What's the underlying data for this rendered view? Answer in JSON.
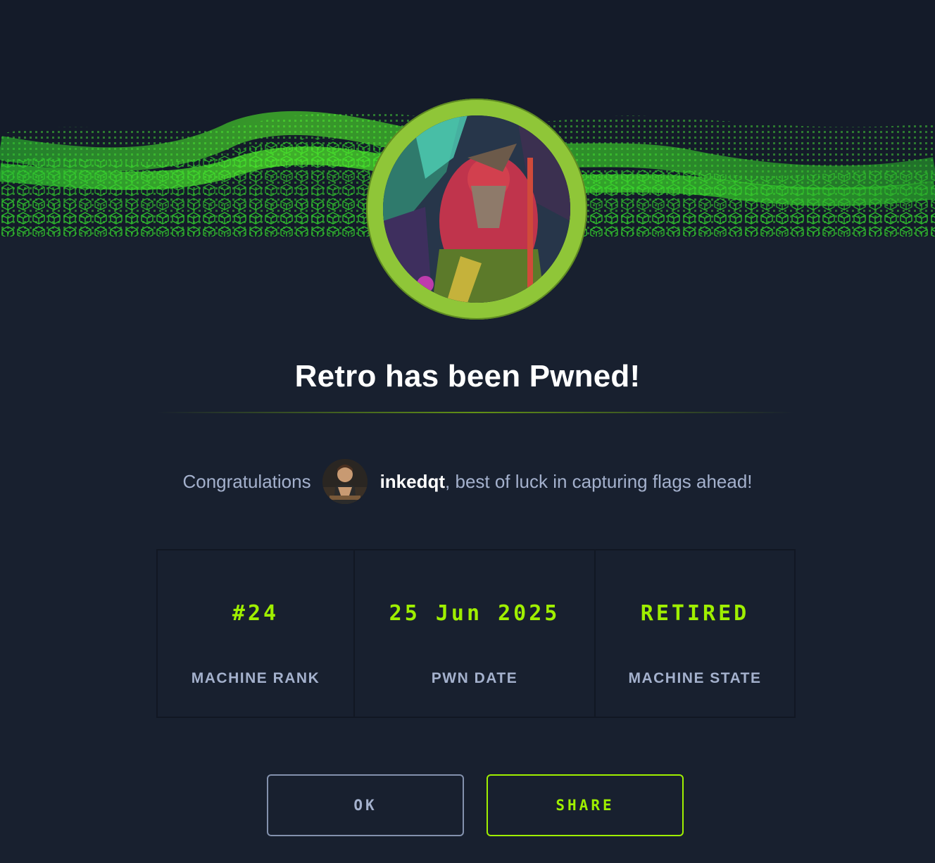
{
  "modal": {
    "title": "Retro has been Pwned!",
    "congrats": {
      "prefix": "Congratulations",
      "username": "inkedqt",
      "suffix": ", best of luck in capturing flags ahead!"
    },
    "stats": [
      {
        "value": "#24",
        "label": "MACHINE RANK"
      },
      {
        "value": "25 Jun 2025",
        "label": "PWN DATE"
      },
      {
        "value": "RETIRED",
        "label": "MACHINE STATE"
      }
    ],
    "buttons": {
      "ok_label": "OK",
      "share_label": "SHARE"
    }
  },
  "colors": {
    "background": "#18202f",
    "accent_green": "#9fef00",
    "ring_green": "#8fc638",
    "muted_text": "#a4b1cd",
    "white": "#ffffff"
  },
  "icons": {
    "machine_avatar": "machine-avatar-image",
    "user_avatar": "user-avatar-image",
    "banner": "green-cube-wave-banner"
  }
}
